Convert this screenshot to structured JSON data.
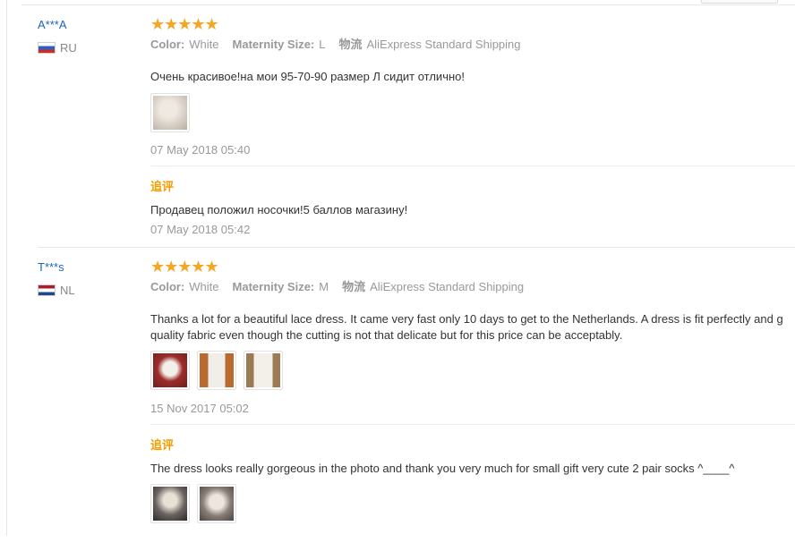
{
  "reviews": [
    {
      "user": "A***A",
      "country": "RU",
      "stars": "★★★★★",
      "color_label": "Color:",
      "color_value": "White",
      "size_label": "Maternity Size:",
      "size_value": "L",
      "shipping_label": "物流",
      "shipping_value": "AliExpress Standard Shipping",
      "text": "Очень красивое!на мои 95-70-90 размер Л сидит отлично!",
      "date": "07 May 2018 05:40",
      "followup_label": "追评",
      "followup_text": "Продавец положил носочки!5 баллов магазину!",
      "followup_date": "07 May 2018 05:42"
    },
    {
      "user": "T***s",
      "country": "NL",
      "stars": "★★★★★",
      "color_label": "Color:",
      "color_value": "White",
      "size_label": "Maternity Size:",
      "size_value": "M",
      "shipping_label": "物流",
      "shipping_value": "AliExpress Standard Shipping",
      "text_line1": "Thanks a lot for a beautiful lace dress. It came very fast only 10 days to get to the Netherlands. A dress is fit perfectly and g",
      "text_line2": "quality fabric even though the cutting is not that delicate but for this price can be acceptably.",
      "date": "15 Nov 2017 05:02",
      "followup_label": "追评",
      "followup_text": "The dress looks really gorgeous in the photo and thank you very much for small gift very cute 2 pair socks ^____^"
    }
  ]
}
